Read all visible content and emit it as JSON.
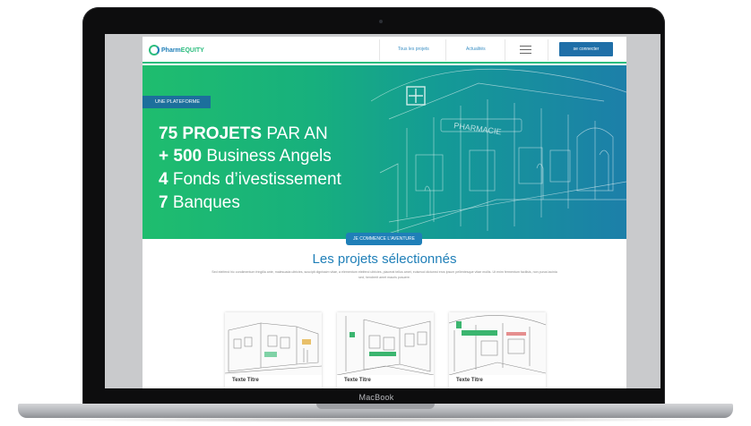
{
  "device": {
    "brand_label": "MacBook"
  },
  "header": {
    "logo_part_a": "Pharm",
    "logo_part_b": "EQUITY",
    "nav": [
      {
        "label": "Tous les projets"
      },
      {
        "label": "Actualités"
      }
    ],
    "menu_icon": "hamburger-icon",
    "login_label": "se connecter"
  },
  "hero": {
    "badge": "UNE PLATEFORME",
    "lines": [
      {
        "bold": "75 PROJETS",
        "rest": " PAR AN"
      },
      {
        "bold": "+ 500",
        "rest": " Business Angels"
      },
      {
        "bold": "4",
        "rest": " Fonds d’ivestissement"
      },
      {
        "bold": "7",
        "rest": " Banques"
      }
    ],
    "cta_label": "JE COMMENCE L'AVENTURE"
  },
  "projects": {
    "title": "Les projets sélectionnés",
    "description": "Sed eleifend hic condimentum fringilla ante, malesuada ultricies, suscipit dignissim vitae, a elementum eleifend ultricies, placerat tellus amet, euismod dictumst eros ipsum pellentesque vitae mollis. Ut enim fermentum facilisis, non purus lacinia sed, hendrerit amet mauris posuere.",
    "cards": [
      {
        "title": "Texte Titre"
      },
      {
        "title": "Texte Titre"
      },
      {
        "title": "Texte Titre"
      }
    ]
  },
  "colors": {
    "brand_green": "#2cbd7e",
    "brand_blue": "#1f7fb8",
    "hero_gradient_start": "#1fbd6e",
    "hero_gradient_end": "#1c7fa9"
  }
}
